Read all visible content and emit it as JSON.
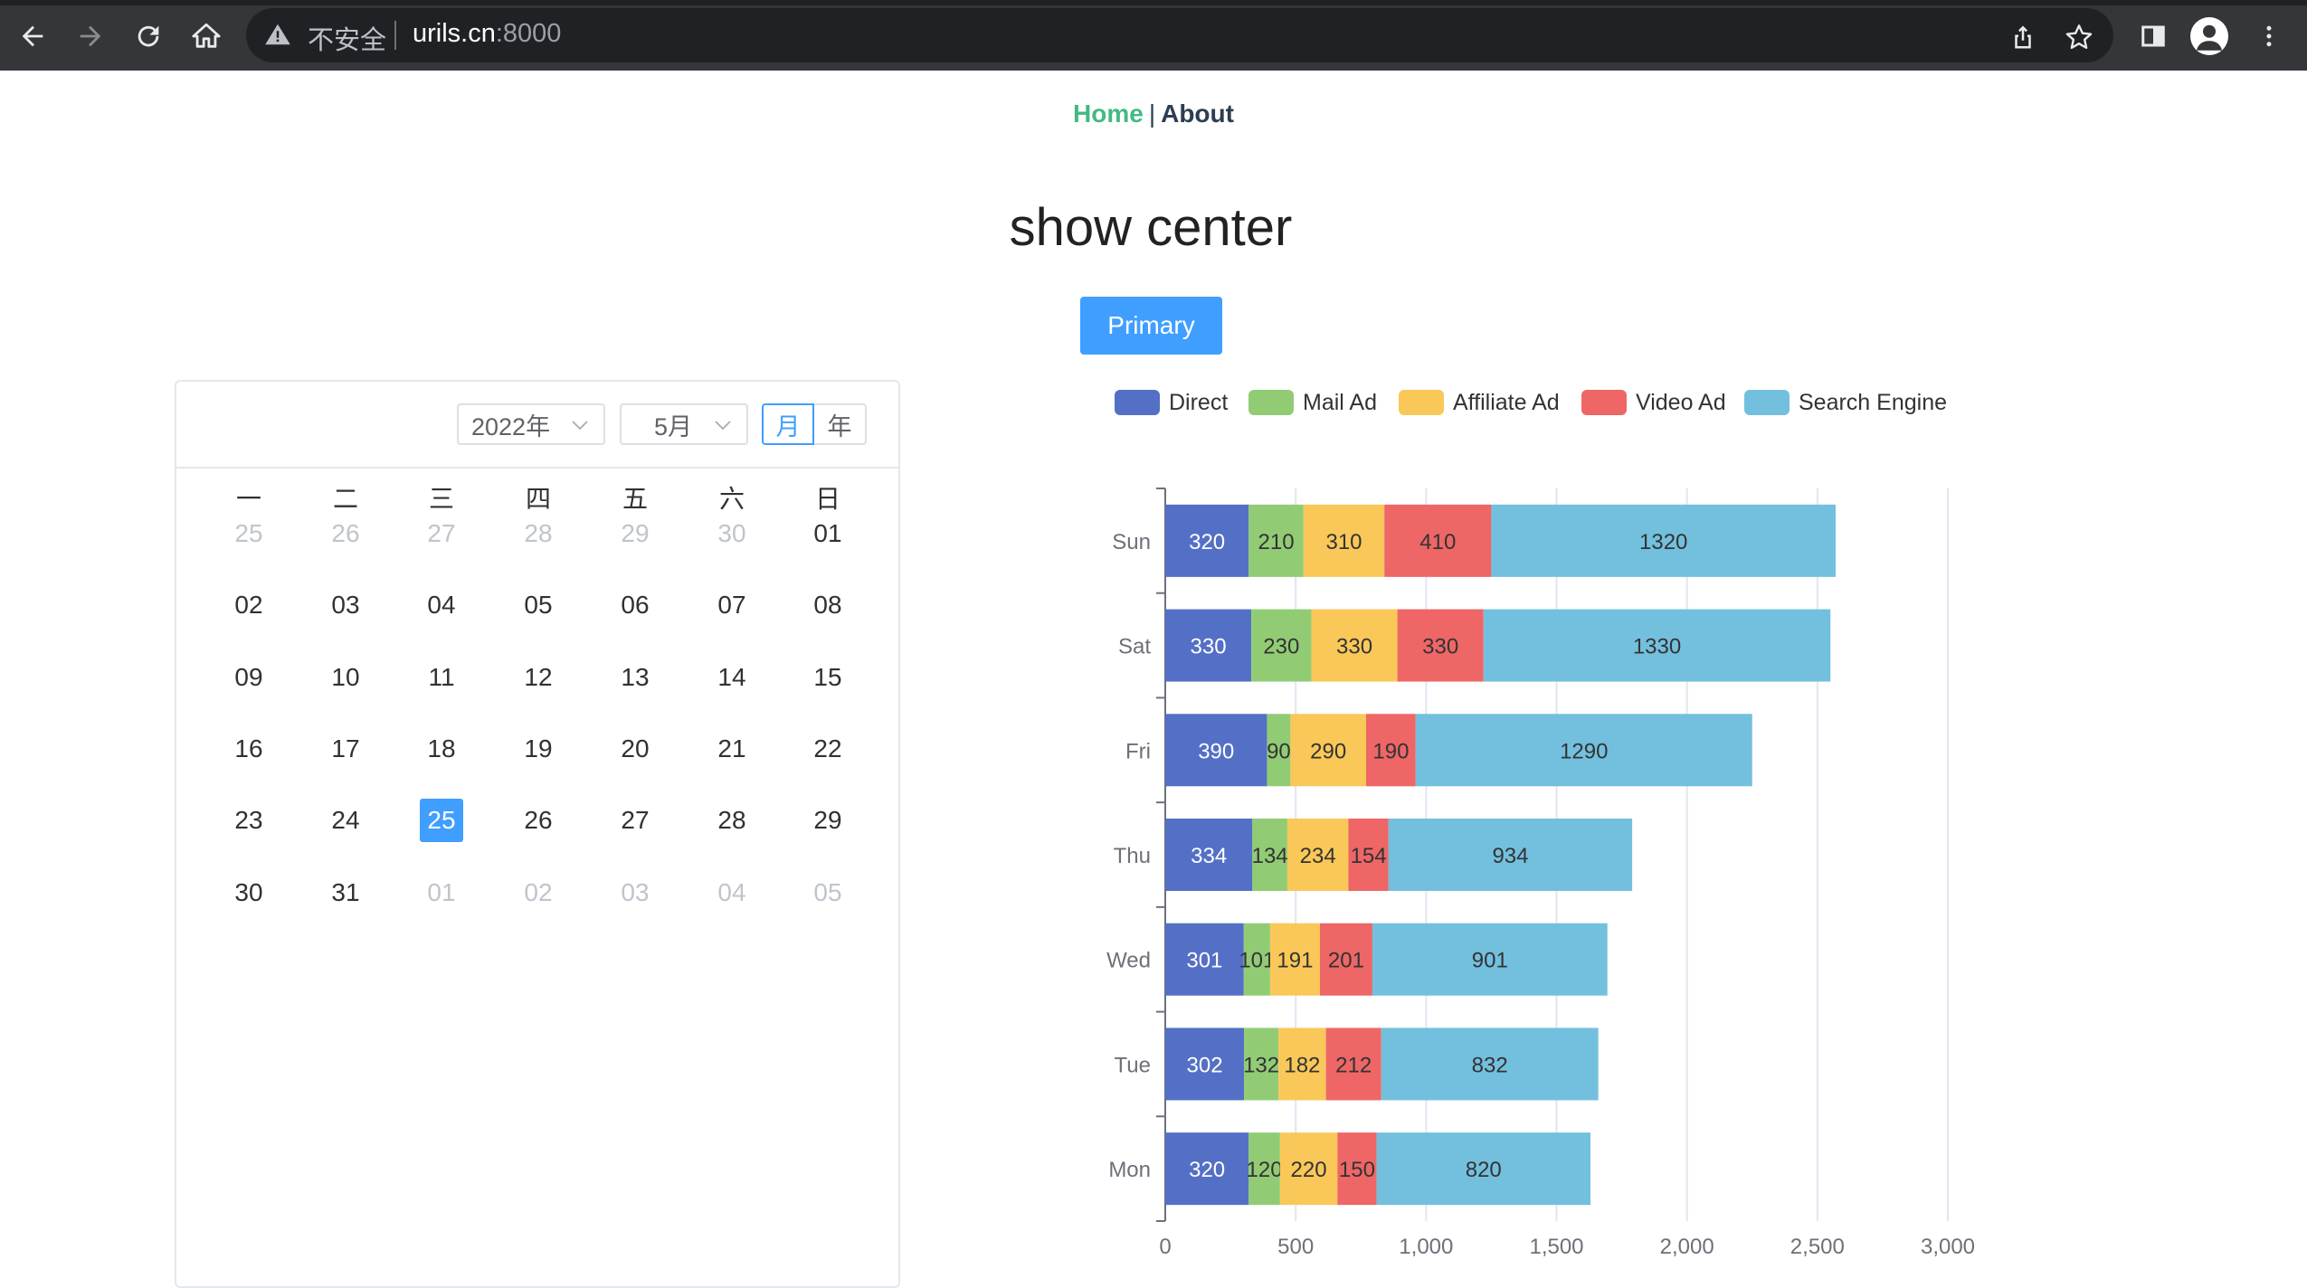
{
  "browser": {
    "insecure_label": "不安全",
    "url_host": "urils.cn",
    "url_port": ":8000"
  },
  "nav": {
    "home": "Home",
    "separator": "|",
    "about": "About"
  },
  "page": {
    "title": "show center",
    "primary_button": "Primary"
  },
  "calendar": {
    "year_select": "2022年",
    "month_select": "5月",
    "mode_month": "月",
    "mode_year": "年",
    "weekdays": [
      "一",
      "二",
      "三",
      "四",
      "五",
      "六",
      "日"
    ],
    "weeks": [
      [
        {
          "d": "25",
          "m": true
        },
        {
          "d": "26",
          "m": true
        },
        {
          "d": "27",
          "m": true
        },
        {
          "d": "28",
          "m": true
        },
        {
          "d": "29",
          "m": true
        },
        {
          "d": "30",
          "m": true
        },
        {
          "d": "01"
        }
      ],
      [
        {
          "d": "02"
        },
        {
          "d": "03"
        },
        {
          "d": "04"
        },
        {
          "d": "05"
        },
        {
          "d": "06"
        },
        {
          "d": "07"
        },
        {
          "d": "08"
        }
      ],
      [
        {
          "d": "09"
        },
        {
          "d": "10"
        },
        {
          "d": "11"
        },
        {
          "d": "12"
        },
        {
          "d": "13"
        },
        {
          "d": "14"
        },
        {
          "d": "15"
        }
      ],
      [
        {
          "d": "16"
        },
        {
          "d": "17"
        },
        {
          "d": "18"
        },
        {
          "d": "19"
        },
        {
          "d": "20"
        },
        {
          "d": "21"
        },
        {
          "d": "22"
        }
      ],
      [
        {
          "d": "23"
        },
        {
          "d": "24"
        },
        {
          "d": "25",
          "today": true
        },
        {
          "d": "26"
        },
        {
          "d": "27"
        },
        {
          "d": "28"
        },
        {
          "d": "29"
        }
      ],
      [
        {
          "d": "30"
        },
        {
          "d": "31"
        },
        {
          "d": "01",
          "m": true
        },
        {
          "d": "02",
          "m": true
        },
        {
          "d": "03",
          "m": true
        },
        {
          "d": "04",
          "m": true
        },
        {
          "d": "05",
          "m": true
        }
      ]
    ]
  },
  "chart_data": {
    "type": "bar",
    "orientation": "horizontal",
    "stacked": true,
    "categories": [
      "Mon",
      "Tue",
      "Wed",
      "Thu",
      "Fri",
      "Sat",
      "Sun"
    ],
    "series": [
      {
        "name": "Direct",
        "color": "#5470c6",
        "values": [
          320,
          302,
          301,
          334,
          390,
          330,
          320
        ]
      },
      {
        "name": "Mail Ad",
        "color": "#91cc75",
        "values": [
          120,
          132,
          101,
          134,
          90,
          230,
          210
        ]
      },
      {
        "name": "Affiliate Ad",
        "color": "#fac858",
        "values": [
          220,
          182,
          191,
          234,
          290,
          330,
          310
        ]
      },
      {
        "name": "Video Ad",
        "color": "#ee6666",
        "values": [
          150,
          212,
          201,
          154,
          190,
          330,
          410
        ]
      },
      {
        "name": "Search Engine",
        "color": "#73c0de",
        "values": [
          820,
          832,
          901,
          934,
          1290,
          1330,
          1320
        ]
      }
    ],
    "xlim": [
      0,
      3000
    ],
    "xticks": [
      "0",
      "500",
      "1,000",
      "1,500",
      "2,000",
      "2,500",
      "3,000"
    ],
    "legend_position": "top",
    "grid": true,
    "data_labels": true
  }
}
